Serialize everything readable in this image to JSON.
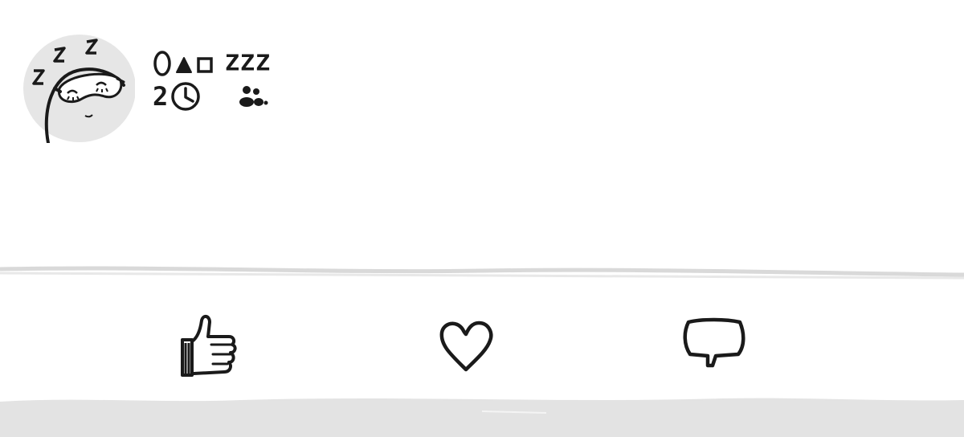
{
  "post": {
    "author": {
      "avatar_icon": "sleeping-face-icon",
      "name_icons": [
        "circle-shape-icon",
        "triangle-shape-icon",
        "square-shape-icon"
      ],
      "name_suffix": "ZZZ"
    },
    "time_value": "2",
    "time_icon": "clock-icon",
    "audience_icon": "friends-icon"
  },
  "actions": [
    {
      "id": "like",
      "icon": "thumbs-up-icon"
    },
    {
      "id": "love",
      "icon": "heart-icon"
    },
    {
      "id": "comment",
      "icon": "speech-bubble-icon"
    }
  ],
  "colors": {
    "ink": "#1a1a1a",
    "avatar_bg": "#e6e6e6",
    "divider": "#d9d9d9",
    "bottom_band": "#e3e3e3"
  }
}
